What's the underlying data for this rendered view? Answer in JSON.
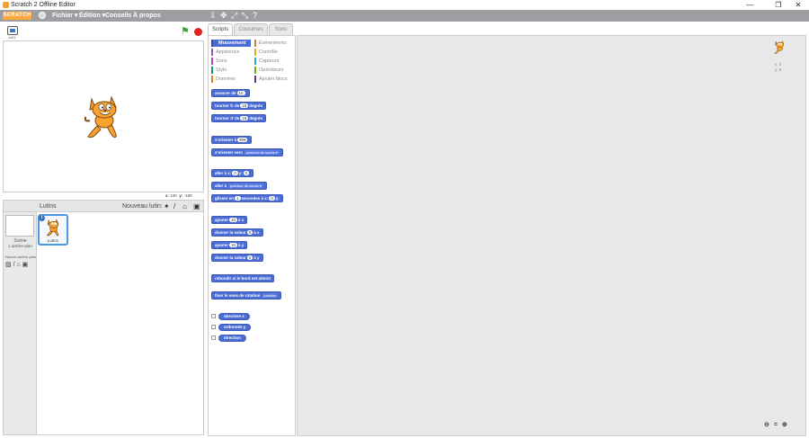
{
  "window": {
    "title": "Scratch 2 Offline Editor",
    "minimize": "—",
    "maximize": "❐",
    "close": "✕"
  },
  "menubar": {
    "logo": "SCRATCH",
    "menus": [
      "Fichier ▾",
      "Édition ▾",
      "Conseils",
      "À propos"
    ],
    "tools": [
      "⇩",
      "✥",
      "⤢",
      "⤡",
      "?"
    ]
  },
  "stage": {
    "version": "v461",
    "mouse_x_label": "x:",
    "mouse_x": "240",
    "mouse_y_label": "y:",
    "mouse_y": "-180"
  },
  "sprites_pane": {
    "title": "Lutins",
    "new_sprite_label": "Nouveau lutin:",
    "new_sprite_icons": [
      "✦",
      "/",
      "⌂",
      "▣"
    ],
    "scene_label": "Scène",
    "scene_count": "1 arrière-plan",
    "new_backdrop_label": "Nouvel arrière-plan",
    "backdrop_icons": [
      "▨",
      "/",
      "⌂",
      "▣"
    ],
    "sprite": {
      "name": "Lutin1",
      "info": "i"
    }
  },
  "tabs": [
    "Scripts",
    "Costumes",
    "Sons"
  ],
  "categories": [
    {
      "label": "Mouvement",
      "color": "#4a6cd4"
    },
    {
      "label": "Apparence",
      "color": "#8a55d7"
    },
    {
      "label": "Sons",
      "color": "#bb42c3"
    },
    {
      "label": "Stylo",
      "color": "#0e9a6c"
    },
    {
      "label": "Données",
      "color": "#ee7d16"
    },
    {
      "label": "Événements",
      "color": "#c88330"
    },
    {
      "label": "Contrôle",
      "color": "#e1a91a"
    },
    {
      "label": "Capteurs",
      "color": "#2ca5e2"
    },
    {
      "label": "Opérateurs",
      "color": "#5cb712"
    },
    {
      "label": "Ajouter blocs",
      "color": "#632d99"
    }
  ],
  "blocks": {
    "move": {
      "a": "avancer de",
      "n": "10"
    },
    "turn_right": {
      "a": "tourner ↻ de",
      "n": "15",
      "b": "degrés"
    },
    "turn_left": {
      "a": "tourner ↺ de",
      "n": "15",
      "b": "degrés"
    },
    "point_dir": {
      "a": "s'orienter à",
      "n": "90▾"
    },
    "point_towards": {
      "a": "s'orienter vers",
      "d": "pointeur de souris ▾"
    },
    "go_xy": {
      "a": "aller à x:",
      "n1": "0",
      "b": "y:",
      "n2": "0"
    },
    "go_to": {
      "a": "aller à",
      "d": "pointeur de souris ▾"
    },
    "glide": {
      "a": "glisser en",
      "n1": "1",
      "b": "secondes à x:",
      "n2": "0",
      "c": "y:"
    },
    "change_x": {
      "a": "ajouter",
      "n": "10",
      "b": "à x"
    },
    "set_x": {
      "a": "donner la valeur",
      "n": "0",
      "b": "à x"
    },
    "change_y": {
      "a": "ajouter",
      "n": "10",
      "b": "à y"
    },
    "set_y": {
      "a": "donner la valeur",
      "n": "0",
      "b": "à y"
    },
    "bounce": {
      "a": "rebondir si le bord est atteint"
    },
    "rotation": {
      "a": "fixer le sens de rotation",
      "d": "position"
    },
    "reporters": [
      "abscisse x",
      "ordonnée y",
      "direction"
    ]
  },
  "script_area": {
    "x_readout": "x: 0",
    "y_readout": "y: 0",
    "zoom_out": "🔍︎−",
    "zoom_reset": "=",
    "zoom_in": "🔍︎+"
  }
}
